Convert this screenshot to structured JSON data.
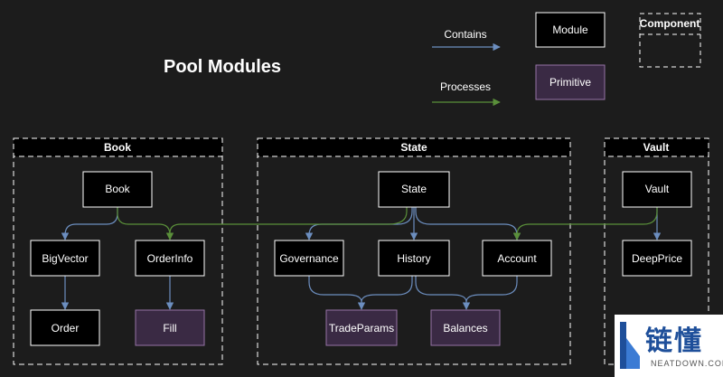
{
  "title": "Pool Modules",
  "legend": {
    "contains": "Contains",
    "processes": "Processes",
    "module": "Module",
    "primitive": "Primitive",
    "component": "Component"
  },
  "groups": {
    "book": "Book",
    "state": "State",
    "vault": "Vault"
  },
  "nodes": {
    "book": "Book",
    "bigvector": "BigVector",
    "orderinfo": "OrderInfo",
    "order": "Order",
    "fill": "Fill",
    "state": "State",
    "governance": "Governance",
    "history": "History",
    "account": "Account",
    "tradeparams": "TradeParams",
    "balances": "Balances",
    "vault": "Vault",
    "deepprice": "DeepPrice"
  },
  "watermark": {
    "text": "链懂",
    "subtext": "NEATDOWN.COM"
  },
  "colors": {
    "background": "#1c1c1c",
    "contains_edge": "#6c8ebf",
    "processes_edge": "#5a8f3a",
    "primitive_fill": "#3a2a44",
    "primitive_stroke": "#9673a6",
    "module_fill": "#000000",
    "module_stroke": "#ffffff"
  }
}
